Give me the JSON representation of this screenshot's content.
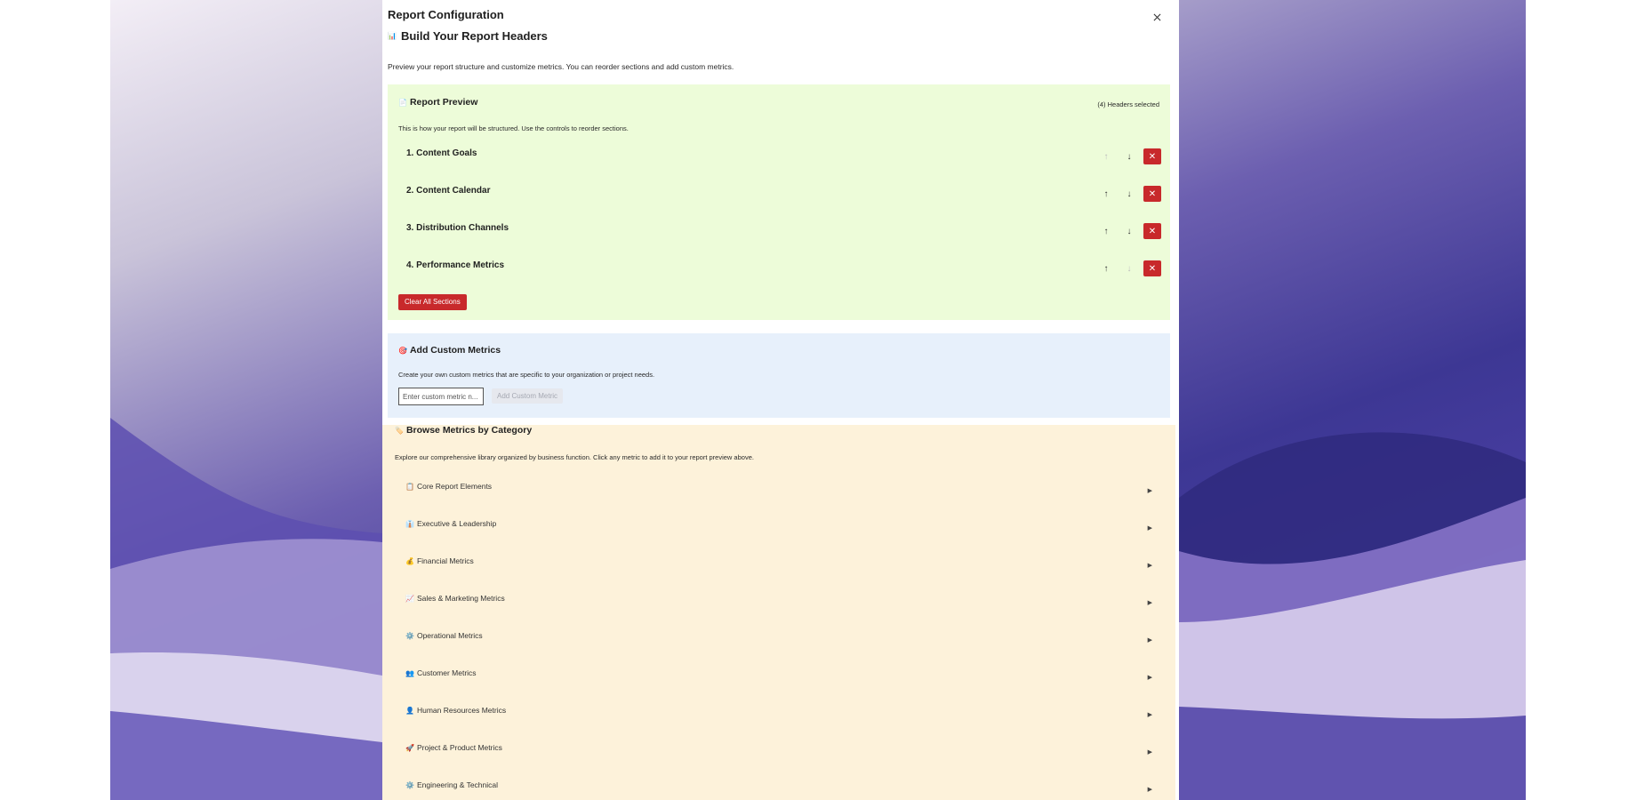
{
  "modal": {
    "title": "Report Configuration",
    "close_label": "×",
    "heading_icon": "📊",
    "heading": "Build Your Report Headers",
    "intro": "Preview your report structure and customize metrics. You can reorder sections and add custom metrics."
  },
  "preview": {
    "icon": "📄",
    "title": "Report Preview",
    "count": "(4) Headers selected",
    "description": "This is how your report will be structured. Use the controls to reorder sections.",
    "sections": [
      {
        "label": "1. Content Goals",
        "up_enabled": false,
        "down_enabled": true
      },
      {
        "label": "2. Content Calendar",
        "up_enabled": true,
        "down_enabled": true
      },
      {
        "label": "3. Distribution Channels",
        "up_enabled": true,
        "down_enabled": true
      },
      {
        "label": "4. Performance Metrics",
        "up_enabled": true,
        "down_enabled": false
      }
    ],
    "up_glyph": "↑",
    "down_glyph": "↓",
    "remove_glyph": "✕",
    "clear_label": "Clear All Sections"
  },
  "custom": {
    "icon": "🎯",
    "title": "Add Custom Metrics",
    "description": "Create your own custom metrics that are specific to your organization or project needs.",
    "input_placeholder": "Enter custom metric n...",
    "add_label": "Add Custom Metric"
  },
  "browse": {
    "icon": "🏷️",
    "title": "Browse Metrics by Category",
    "description": "Explore our comprehensive library organized by business function. Click any metric to add it to your report preview above.",
    "caret": "▶",
    "categories": [
      {
        "icon": "📋",
        "label": "Core Report Elements"
      },
      {
        "icon": "👔",
        "label": "Executive & Leadership"
      },
      {
        "icon": "💰",
        "label": "Financial Metrics"
      },
      {
        "icon": "📈",
        "label": "Sales & Marketing Metrics"
      },
      {
        "icon": "⚙️",
        "label": "Operational Metrics"
      },
      {
        "icon": "👥",
        "label": "Customer Metrics"
      },
      {
        "icon": "👤",
        "label": "Human Resources Metrics"
      },
      {
        "icon": "🚀",
        "label": "Project & Product Metrics"
      },
      {
        "icon": "⚙️",
        "label": "Engineering & Technical"
      }
    ]
  },
  "colors": {
    "accent_red": "#c8292b",
    "preview_bg": "#edfcd9",
    "custom_bg": "#e7f0fb",
    "browse_bg": "#fdf2da"
  }
}
